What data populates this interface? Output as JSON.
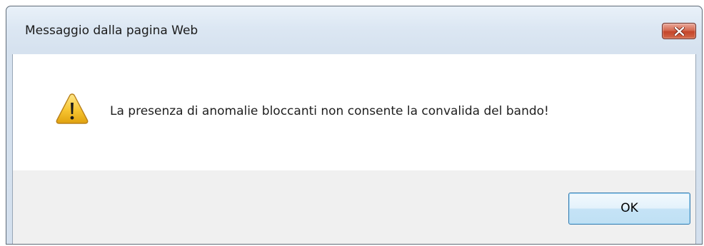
{
  "window": {
    "title": "Messaggio dalla pagina Web",
    "close_icon": "close-x-icon"
  },
  "message": {
    "icon": "warning-icon",
    "text": "La presenza di anomalie bloccanti non consente la convalida del bando!"
  },
  "buttons": {
    "ok_label": "OK"
  },
  "colors": {
    "titlebar": "#dce7f3",
    "close_button": "#c4452a",
    "warning_fill": "#f7c531",
    "button_area": "#f0f0f0",
    "ok_border": "#3c7fb1"
  }
}
